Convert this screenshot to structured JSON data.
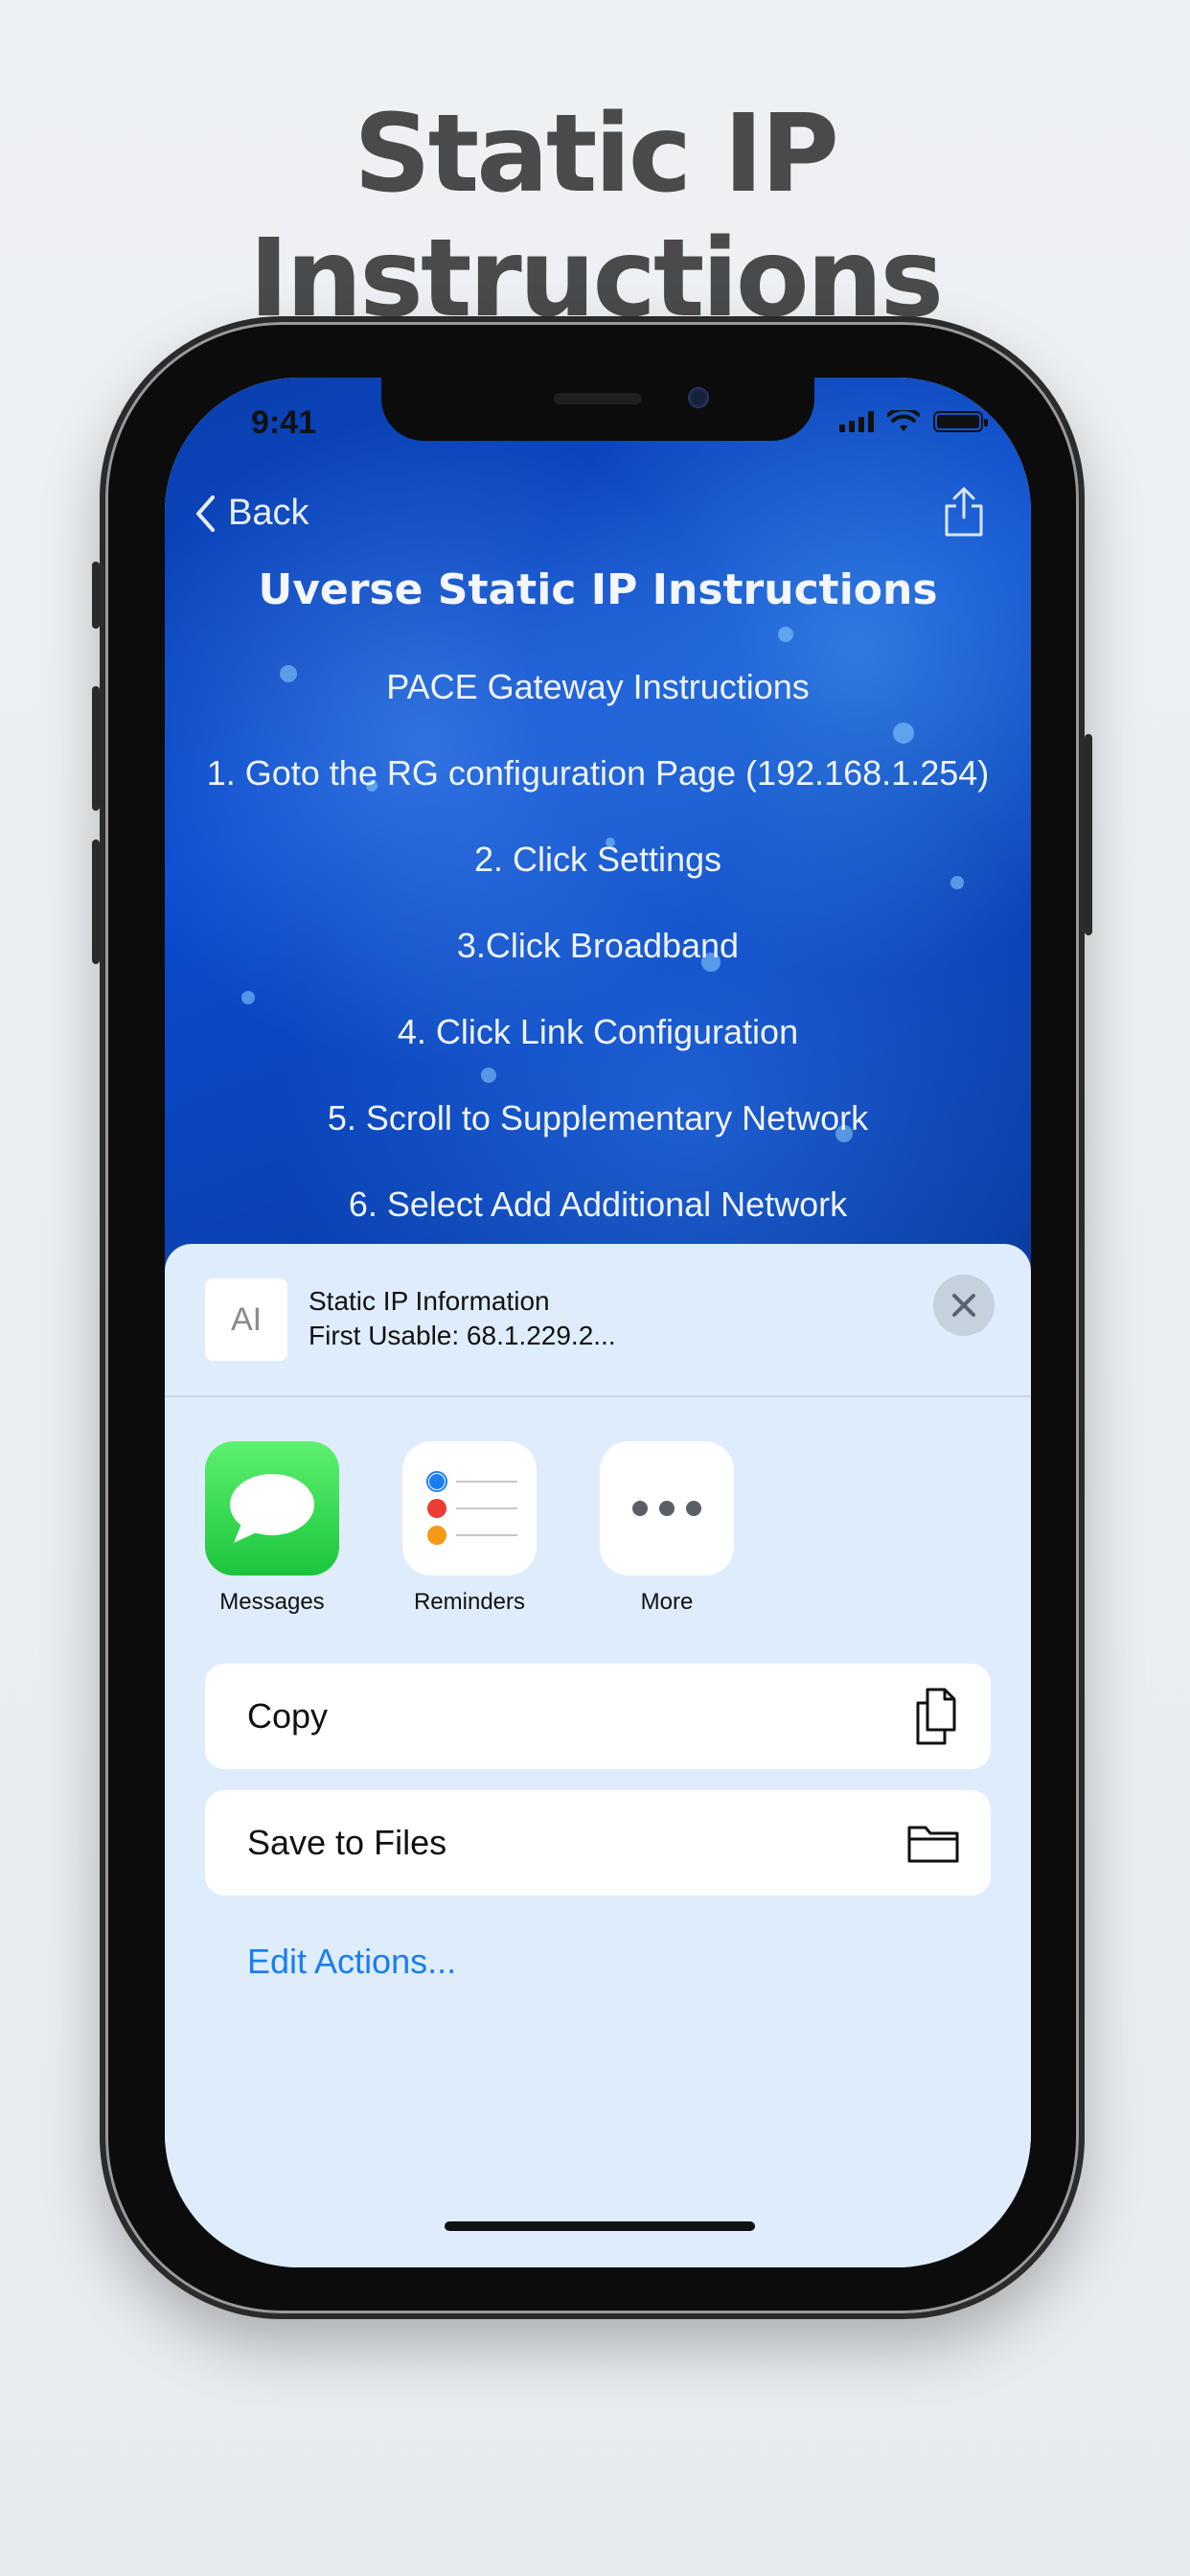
{
  "headline": "Static IP Instructions",
  "status_bar": {
    "time": "9:41"
  },
  "nav": {
    "back_label": "Back"
  },
  "page": {
    "heading": "Uverse Static IP Instructions",
    "lines": [
      "PACE Gateway Instructions",
      "1. Goto the RG configuration Page (192.168.1.254)",
      "2. Click Settings",
      "3.Click Broadband",
      "4. Click Link Configuration",
      "5. Scroll to Supplementary Network",
      "6. Select Add Additional Network"
    ]
  },
  "share_sheet": {
    "thumb_glyph": "AI",
    "title": "Static IP Information",
    "subtitle": "First Usable: 68.1.229.2...",
    "apps": [
      {
        "label": "Messages",
        "icon": "messages-icon"
      },
      {
        "label": "Reminders",
        "icon": "reminders-icon"
      },
      {
        "label": "More",
        "icon": "more-icon"
      }
    ],
    "actions": [
      {
        "label": "Copy",
        "icon": "copy-icon"
      },
      {
        "label": "Save to Files",
        "icon": "folder-icon"
      }
    ],
    "edit_actions": "Edit Actions..."
  },
  "colors": {
    "link_blue": "#1a7ef0",
    "sheet_bg": "#dfecfb",
    "background_blue": "#0b4bd0"
  }
}
